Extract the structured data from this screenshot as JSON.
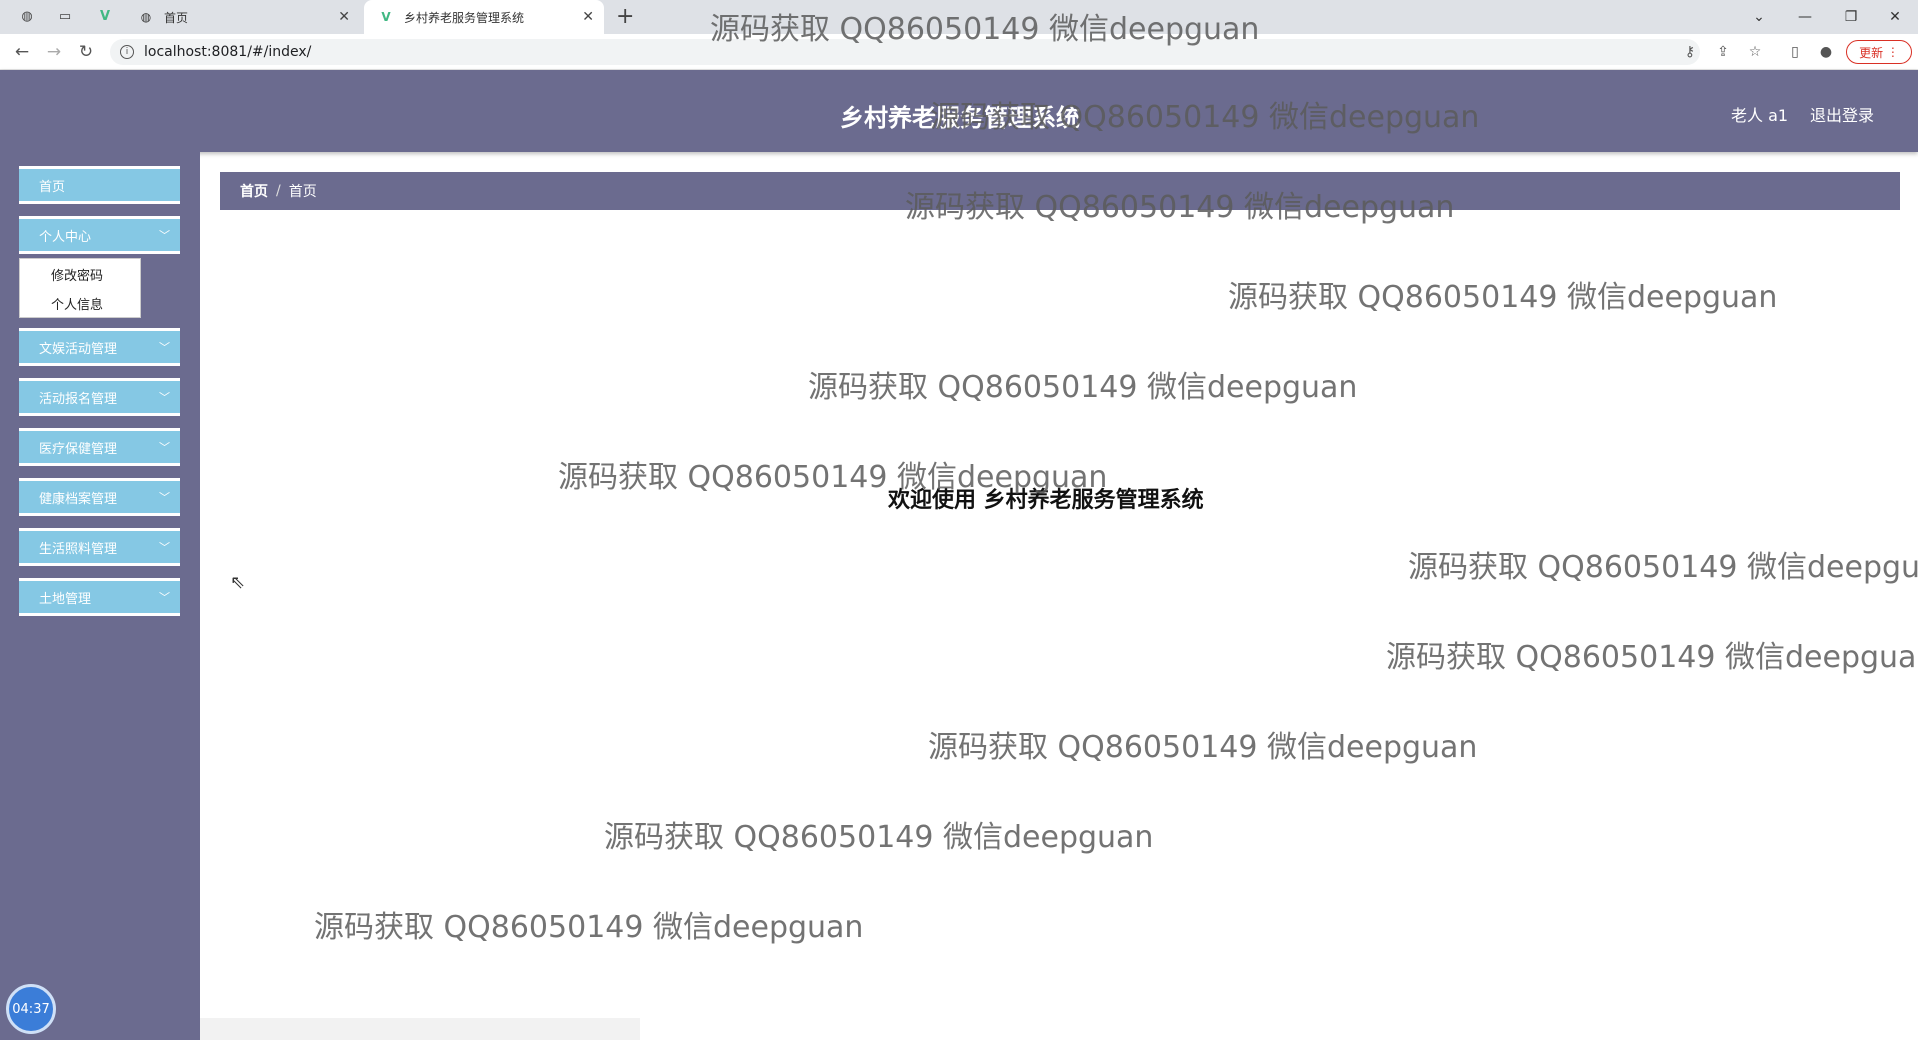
{
  "browser": {
    "tabs": [
      {
        "label": "首页",
        "active": false
      },
      {
        "label": "乡村养老服务管理系统",
        "active": true
      }
    ],
    "url": "localhost:8081/#/index/",
    "update_label": "更新"
  },
  "watermark_text": "源码获取 QQ86050149 微信deepguan",
  "app": {
    "title": "乡村养老服务管理系统",
    "user": "老人 a1",
    "logout": "退出登录"
  },
  "sidebar": {
    "items": [
      {
        "label": "首页"
      },
      {
        "label": "个人中心",
        "expandable": true
      },
      {
        "label": "文娱活动管理",
        "expandable": true
      },
      {
        "label": "活动报名管理",
        "expandable": true
      },
      {
        "label": "医疗保健管理",
        "expandable": true
      },
      {
        "label": "健康档案管理",
        "expandable": true
      },
      {
        "label": "生活照料管理",
        "expandable": true
      },
      {
        "label": "土地管理",
        "expandable": true
      }
    ],
    "submenu": [
      {
        "label": "修改密码"
      },
      {
        "label": "个人信息"
      }
    ]
  },
  "breadcrumb": [
    "首页",
    "首页"
  ],
  "welcome": "欢迎使用 乡村养老服务管理系统",
  "clock": "04:37",
  "colors": {
    "header": "#6b6b8f",
    "menu_button": "#85c8e4",
    "accent_update": "#d93025"
  }
}
